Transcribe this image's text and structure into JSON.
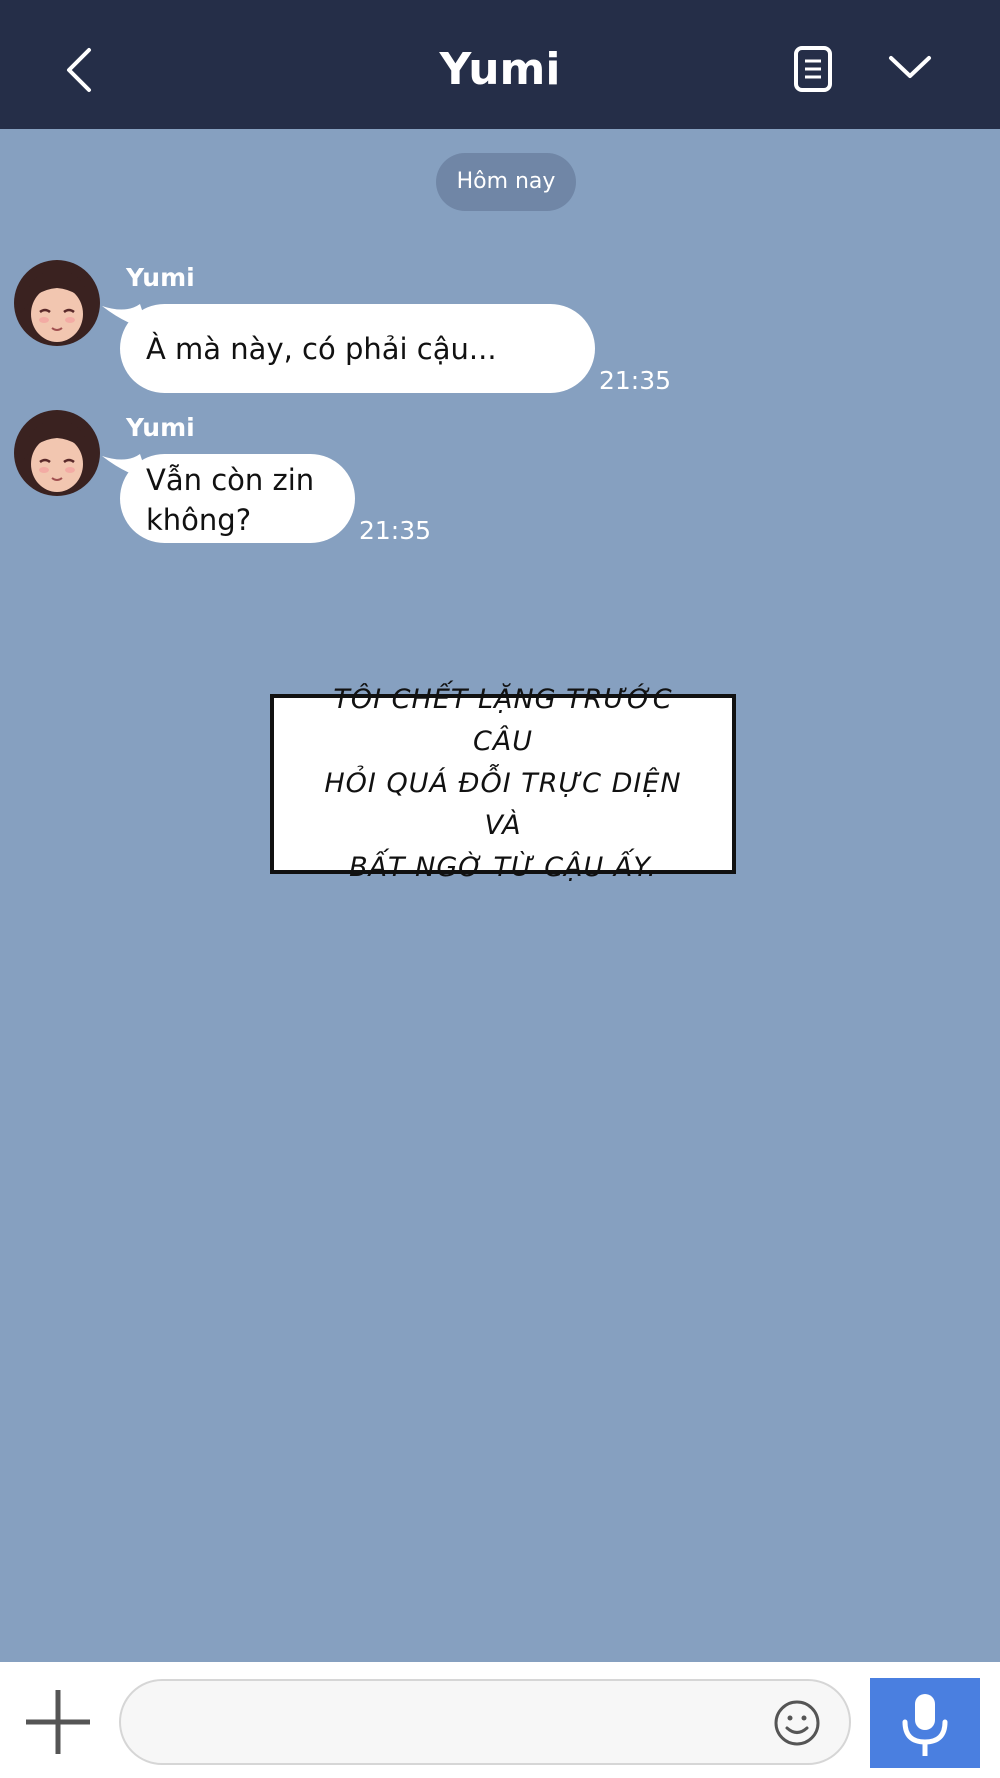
{
  "header": {
    "title": "Yumi",
    "back_icon": "chevron-left-icon",
    "notes_icon": "notes-icon",
    "menu_icon": "chevron-down-icon"
  },
  "date_separator": "Hôm nay",
  "messages": [
    {
      "sender": "Yumi",
      "lines": [
        "À mà này, có phải cậu..."
      ],
      "time": "21:35"
    },
    {
      "sender": "Yumi",
      "lines": [
        "Vẫn còn zin",
        "không?"
      ],
      "time": "21:35"
    }
  ],
  "caption": {
    "lines": [
      "TÔI CHẾT LẶNG TRƯỚC CÂU",
      "HỎI QUÁ ĐỖI TRỰC DIỆN VÀ",
      "BẤT NGỜ TỪ CẬU ẤY."
    ]
  },
  "input_bar": {
    "placeholder": "",
    "plus_icon": "plus-icon",
    "emoji_icon": "emoji-icon",
    "mic_icon": "microphone-icon"
  },
  "colors": {
    "header_bg": "#252e48",
    "chat_bg": "#86a0c0",
    "mic_button": "#4a7fe0"
  }
}
